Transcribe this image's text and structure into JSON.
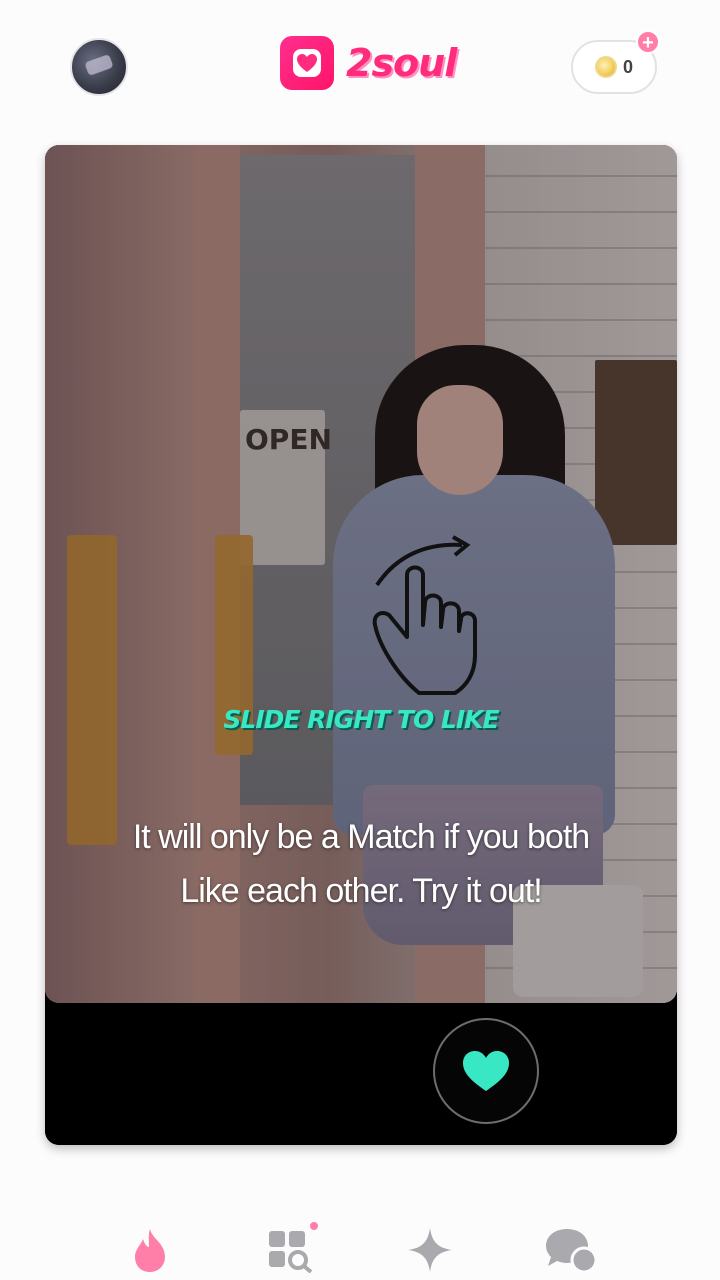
{
  "header": {
    "avatar_alt": "profile",
    "logo_text": "2soul",
    "coins": {
      "count": "0",
      "plus": "+"
    }
  },
  "card": {
    "photo_sign_text": "OPEN",
    "hint_title": "SLIDE RIGHT TO LIKE",
    "hint_body_line1": "It will only be a Match if you both",
    "hint_body_line2": "Like each other. Try it out!"
  },
  "colors": {
    "brand_pink": "#ff2b7c",
    "accent_teal": "#38e8c5",
    "nav_active": "#ff7fa8"
  },
  "bottom_nav": {
    "items": [
      {
        "icon": "flame-icon",
        "active": true
      },
      {
        "icon": "discover-grid-icon",
        "active": false,
        "badge": true
      },
      {
        "icon": "sparkle-icon",
        "active": false
      },
      {
        "icon": "chat-bubbles-icon",
        "active": false
      }
    ]
  }
}
